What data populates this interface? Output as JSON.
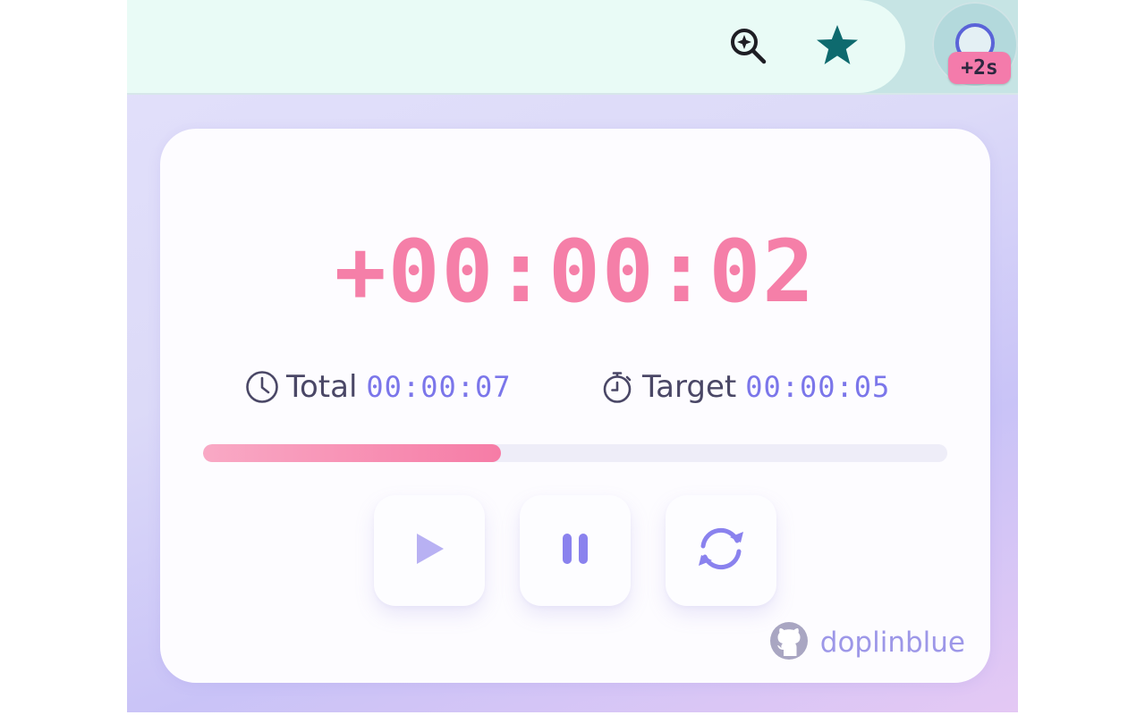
{
  "toolbar": {
    "zoom_icon": "zoom-in-icon",
    "bookmark_icon": "star-icon",
    "extension_badge": "+2s"
  },
  "timer": {
    "main_time": "+00:00:02",
    "total_label": "Total",
    "total_value": "00:00:07",
    "target_label": "Target",
    "target_value": "00:00:05",
    "progress_fraction": 0.4
  },
  "controls": {
    "play_icon": "play-icon",
    "pause_icon": "pause-icon",
    "reset_icon": "reset-icon"
  },
  "credit": {
    "icon": "github-icon",
    "text": "doplinblue"
  },
  "colors": {
    "accent_pink": "#f57fa8",
    "accent_violet": "#7b76ea",
    "star": "#0e6a6e"
  }
}
